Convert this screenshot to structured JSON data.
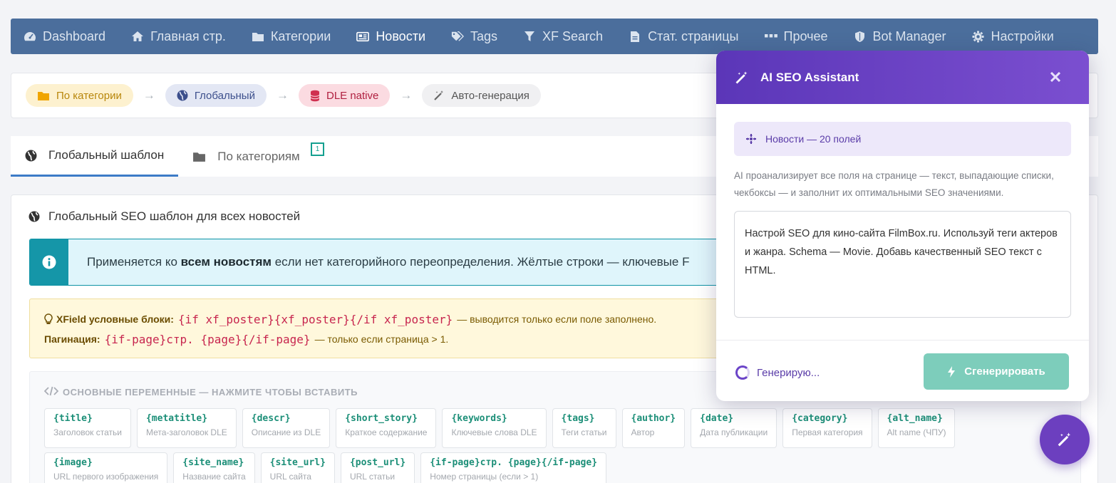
{
  "nav": {
    "items": [
      {
        "label": "Dashboard",
        "icon": "dashboard-icon"
      },
      {
        "label": "Главная стр.",
        "icon": "home-icon"
      },
      {
        "label": "Категории",
        "icon": "folder-icon"
      },
      {
        "label": "Новости",
        "icon": "newspaper-icon",
        "active": true
      },
      {
        "label": "Tags",
        "icon": "tags-icon"
      },
      {
        "label": "XF Search",
        "icon": "filter-icon"
      },
      {
        "label": "Стат. страницы",
        "icon": "file-icon"
      },
      {
        "label": "Прочее",
        "icon": "ellipsis-icon"
      },
      {
        "label": "Bot Manager",
        "icon": "shield-icon"
      },
      {
        "label": "Настройки",
        "icon": "gear-icon"
      }
    ]
  },
  "flow": {
    "steps": [
      "По категории",
      "Глобальный",
      "DLE native",
      "Авто-генерация"
    ],
    "arrow": "→"
  },
  "tabs": {
    "global": "Глобальный шаблон",
    "by_category": "По категориям",
    "badge": "1"
  },
  "card": {
    "title": "Глобальный SEO шаблон для всех новостей",
    "info_prefix": "Применяется ко ",
    "info_bold": "всем новостям",
    "info_suffix": " если нет категорийного переопределения. Жёлтые строки — ключевые F",
    "xfield_label": "XField условные блоки:",
    "xfield_code": "{if xf_poster}{xf_poster}{/if xf_poster}",
    "xfield_note": "— выводится только если поле заполнено.",
    "pagination_label": "Пагинация:",
    "pagination_code": "{if-page}стр. {page}{/if-page}",
    "pagination_note": "— только если страница > 1.",
    "vars_heading": "ОСНОВНЫЕ ПЕРЕМЕННЫЕ — НАЖМИТЕ ЧТОБЫ ВСТАВИТЬ",
    "vars": [
      {
        "code": "{title}",
        "desc": "Заголовок статьи"
      },
      {
        "code": "{metatitle}",
        "desc": "Мета-заголовок DLE"
      },
      {
        "code": "{descr}",
        "desc": "Описание из DLE"
      },
      {
        "code": "{short_story}",
        "desc": "Краткое содержание"
      },
      {
        "code": "{keywords}",
        "desc": "Ключевые слова DLE"
      },
      {
        "code": "{tags}",
        "desc": "Теги статьи"
      },
      {
        "code": "{author}",
        "desc": "Автор"
      },
      {
        "code": "{date}",
        "desc": "Дата публикации"
      },
      {
        "code": "{category}",
        "desc": "Первая категория"
      },
      {
        "code": "{alt_name}",
        "desc": "Alt name (ЧПУ)"
      },
      {
        "code": "{image}",
        "desc": "URL первого изображения"
      },
      {
        "code": "{site_name}",
        "desc": "Название сайта"
      },
      {
        "code": "{site_url}",
        "desc": "URL сайта"
      },
      {
        "code": "{post_url}",
        "desc": "URL статьи"
      },
      {
        "code": "{if-page}стр. {page}{/if-page}",
        "desc": "Номер страницы (если > 1)"
      }
    ]
  },
  "modal": {
    "title": "AI SEO Assistant",
    "badge": "Новости — 20 полей",
    "description": "AI проанализирует все поля на странице — текст, выпадающие списки, чекбоксы — и заполнит их оптимальными SEO значениями.",
    "prompt": "Настрой SEO для кино-сайта FilmBox.ru. Используй теги актеров и жанра. Schema — Movie. Добавь качественный SEO текст с HTML.",
    "status": "Генерирую...",
    "generate_label": "Сгенерировать"
  },
  "colors": {
    "nav_bg": "#4b6e9c",
    "modal_accent": "#6b44c8",
    "generate_button": "#7dcdbb",
    "code_green": "#1c8f78",
    "code_red": "#c7254e"
  }
}
